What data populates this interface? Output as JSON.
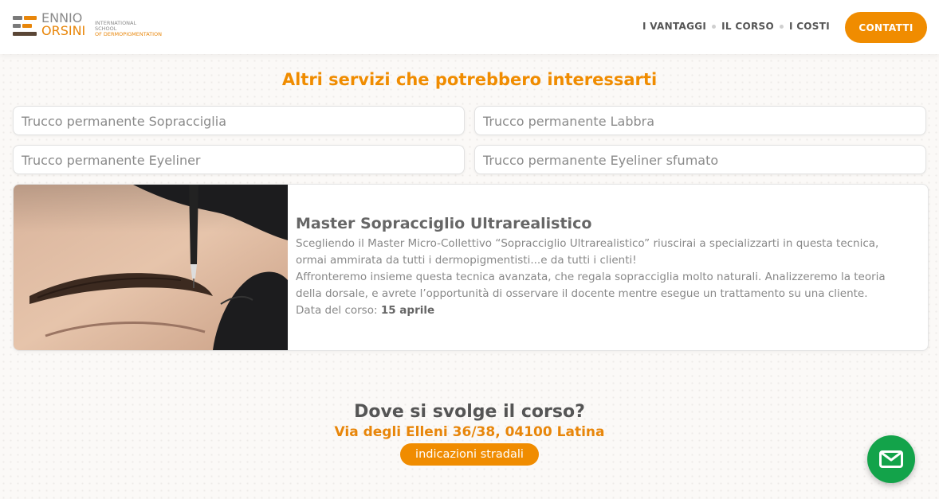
{
  "brand": {
    "name_line1": "ENNIO",
    "name_line2": "ORSINI",
    "sub_line1": "INTERNATIONAL",
    "sub_line2": "SCHOOL",
    "sub_line3": "OF DERMOPIGMENTATION"
  },
  "nav": {
    "items": [
      {
        "label": "I VANTAGGI"
      },
      {
        "label": "IL CORSO"
      },
      {
        "label": "I COSTI"
      }
    ],
    "cta_label": "CONTATTI"
  },
  "services": {
    "title": "Altri servizi che potrebbero interessarti",
    "items": [
      {
        "label": "Trucco permanente Sopracciglia"
      },
      {
        "label": "Trucco permanente Labbra"
      },
      {
        "label": "Trucco permanente Eyeliner"
      },
      {
        "label": "Trucco permanente Eyeliner sfumato"
      }
    ]
  },
  "course": {
    "title": "Master Sopracciglio Ultrarealistico",
    "paragraph1": "Scegliendo il Master Micro-Collettivo “Sopracciglio Ultrarealistico” riuscirai a specializzarti in questa tecnica, ormai ammirata da tutti i dermopigmentisti...e da tutti i clienti!",
    "paragraph2": "Affronteremo insieme questa tecnica avanzata, che regala sopracciglia molto naturali. Analizzeremo la teoria della dorsale, e avrete l’opportunità di osservare il docente mentre esegue un trattamento su una cliente.",
    "date_label": "Data del corso:",
    "date_value": "15 aprile"
  },
  "location": {
    "title": "Dove si svolge il corso?",
    "address": "Via degli Elleni 36/38, 04100 Latina",
    "button_label": "indicazioni stradali"
  },
  "icons": {
    "logo": "logo-mark-icon",
    "fab": "mail-icon"
  },
  "colors": {
    "accent": "#f08c00",
    "fab": "#13a34a"
  }
}
